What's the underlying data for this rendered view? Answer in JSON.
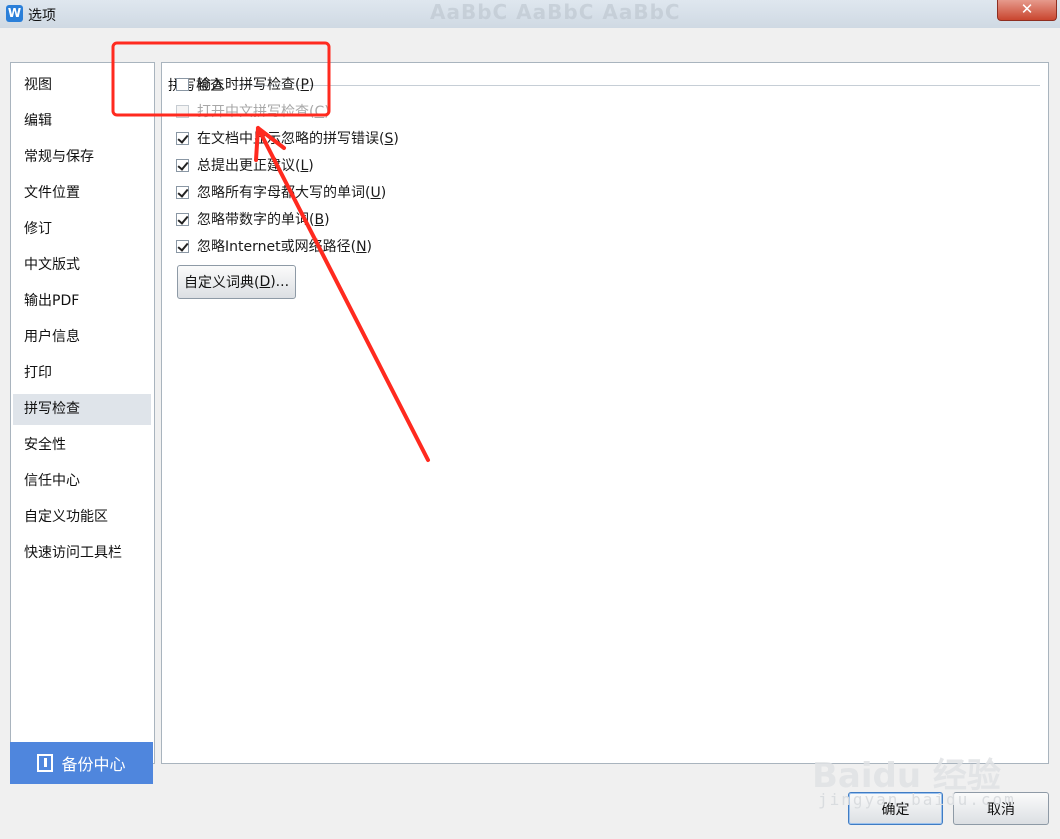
{
  "window": {
    "title": "选项",
    "app_icon": "W",
    "close_label": "✕",
    "background_text": "AaBbC AaBbC AaBbC"
  },
  "sidebar": {
    "items": [
      {
        "label": "视图"
      },
      {
        "label": "编辑"
      },
      {
        "label": "常规与保存"
      },
      {
        "label": "文件位置"
      },
      {
        "label": "修订"
      },
      {
        "label": "中文版式"
      },
      {
        "label": "输出PDF"
      },
      {
        "label": "用户信息"
      },
      {
        "label": "打印"
      },
      {
        "label": "拼写检查",
        "active": true
      },
      {
        "label": "安全性"
      },
      {
        "label": "信任中心"
      },
      {
        "label": "自定义功能区"
      },
      {
        "label": "快速访问工具栏"
      }
    ],
    "backup_label": "备份中心"
  },
  "spellcheck": {
    "group_title": "拼写检查",
    "options": [
      {
        "text": "输入时拼写检查(",
        "key": "P",
        "suffix": ")",
        "checked": false,
        "disabled": false
      },
      {
        "text": "打开中文拼写检查(",
        "key": "C",
        "suffix": ")",
        "checked": false,
        "disabled": true
      },
      {
        "text": "在文档中显示忽略的拼写错误(",
        "key": "S",
        "suffix": ")",
        "checked": true,
        "disabled": false
      },
      {
        "text": "总提出更正建议(",
        "key": "L",
        "suffix": ")",
        "checked": true,
        "disabled": false
      },
      {
        "text": "忽略所有字母都大写的单词(",
        "key": "U",
        "suffix": ")",
        "checked": true,
        "disabled": false
      },
      {
        "text": "忽略带数字的单词(",
        "key": "B",
        "suffix": ")",
        "checked": true,
        "disabled": false
      },
      {
        "text": "忽略Internet或网络路径(",
        "key": "N",
        "suffix": ")",
        "checked": true,
        "disabled": false
      }
    ],
    "custom_dict_prefix": "自定义词典(",
    "custom_dict_key": "D",
    "custom_dict_suffix": ")..."
  },
  "footer": {
    "ok_label": "确定",
    "cancel_label": "取消"
  },
  "watermark": {
    "main": "Baidu 经验",
    "sub": "jingyan.baidu.com"
  },
  "annotation": {
    "color": "#ff2a1f"
  }
}
